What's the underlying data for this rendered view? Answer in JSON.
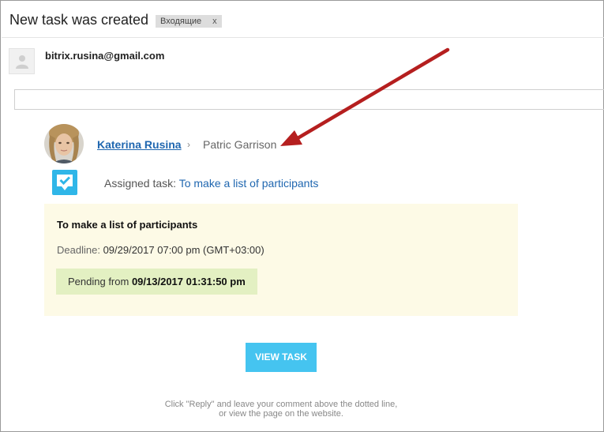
{
  "email": {
    "subject": "New task was created",
    "label": "Входящие",
    "label_close": "x",
    "sender": "bitrix.rusina@gmail.com"
  },
  "task": {
    "author": "Katerina Rusina",
    "separator": "›",
    "assignee": "Patric Garrison",
    "assigned_prefix": "Assigned task:",
    "assigned_link": "To make a list of participants",
    "title": "To make a list of participants",
    "deadline_label": "Deadline:",
    "deadline_value": "09/29/2017 07:00 pm (GMT+03:00)",
    "status_prefix": "Pending from",
    "status_date": "09/13/2017 01:31:50 pm",
    "button_label": "VIEW TASK"
  },
  "footer": {
    "line1": "Click \"Reply\" and leave your comment above the dotted line,",
    "line2": "or view the page on the website."
  },
  "colors": {
    "link": "#2067b0",
    "button": "#45c4f0",
    "card_bg": "#fdfae6",
    "status_bg": "#e3f0c2",
    "arrow": "#b51f1f"
  }
}
